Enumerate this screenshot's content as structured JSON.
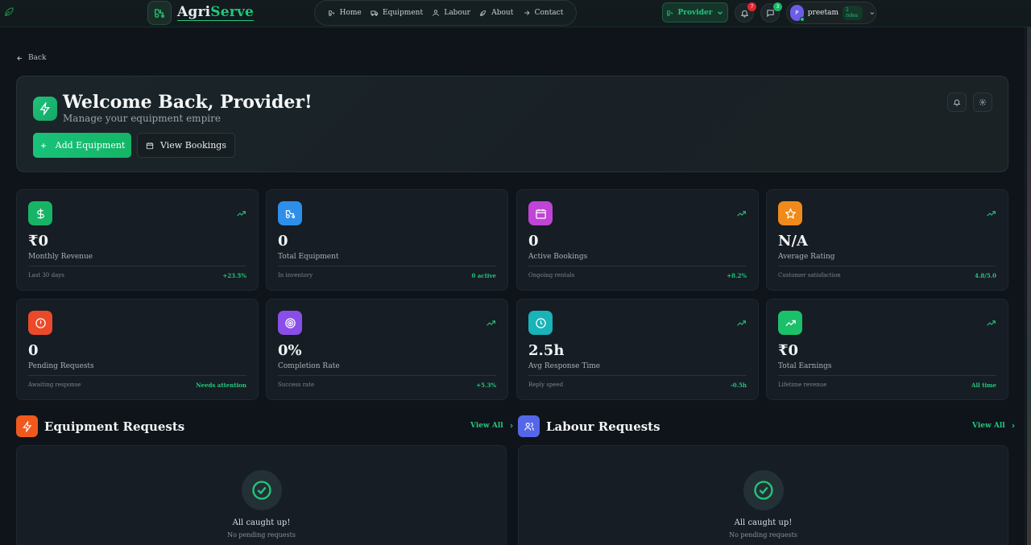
{
  "brand": {
    "name_part1": "Agri",
    "name_part2": "Serve"
  },
  "nav": [
    {
      "label": "Home",
      "icon": "tractor-icon"
    },
    {
      "label": "Equipment",
      "icon": "truck-icon"
    },
    {
      "label": "Labour",
      "icon": "user-icon"
    },
    {
      "label": "About",
      "icon": "leaf-icon"
    },
    {
      "label": "Contact",
      "icon": "arrow-right-icon"
    }
  ],
  "header": {
    "role_label": "Provider",
    "notifications_count": "7",
    "messages_count": "3",
    "user_initial": "P",
    "user_name": "preetam",
    "roles_badge": "2 roles"
  },
  "back_label": "Back",
  "hero": {
    "title": "Welcome Back, Provider!",
    "subtitle": "Manage your equipment empire",
    "add_equipment_label": "Add Equipment",
    "view_bookings_label": "View Bookings"
  },
  "stats": [
    {
      "value": "₹0",
      "label": "Monthly Revenue",
      "foot": "Last 30 days",
      "foot_value": "+23.5%",
      "icon": "dollar-icon",
      "color": "#18b466"
    },
    {
      "value": "0",
      "label": "Total Equipment",
      "foot": "In inventory",
      "foot_value": "0 active",
      "icon": "tractor-icon",
      "color": "#2d8fea"
    },
    {
      "value": "0",
      "label": "Active Bookings",
      "foot": "Ongoing rentals",
      "foot_value": "+8.2%",
      "icon": "calendar-icon",
      "color": "#c044d6"
    },
    {
      "value": "N/A",
      "label": "Average Rating",
      "foot": "Customer satisfaction",
      "foot_value": "4.8/5.0",
      "icon": "star-icon",
      "color": "#f08a1a"
    },
    {
      "value": "0",
      "label": "Pending Requests",
      "foot": "Awaiting response",
      "foot_value": "Needs attention",
      "icon": "alert-icon",
      "color": "#ea4a2a"
    },
    {
      "value": "0%",
      "label": "Completion Rate",
      "foot": "Success rate",
      "foot_value": "+5.3%",
      "icon": "target-icon",
      "color": "#8a4ee8"
    },
    {
      "value": "2.5h",
      "label": "Avg Response Time",
      "foot": "Reply speed",
      "foot_value": "-0.5h",
      "icon": "clock-icon",
      "color": "#19b3b8"
    },
    {
      "value": "₹0",
      "label": "Total Earnings",
      "foot": "Lifetime revenue",
      "foot_value": "All time",
      "icon": "trending-up-icon",
      "color": "#1cbf6a"
    }
  ],
  "equipment_requests": {
    "title": "Equipment Requests",
    "view_all": "View All",
    "empty_title": "All caught up!",
    "empty_sub": "No pending requests",
    "icon_color": "#f0591e"
  },
  "labour_requests": {
    "title": "Labour Requests",
    "view_all": "View All",
    "empty_title": "All caught up!",
    "empty_sub": "No pending requests",
    "icon_color": "#5567e8"
  },
  "colors": {
    "accent": "#22c77a",
    "background": "#0f141b",
    "card": "#161d24"
  }
}
